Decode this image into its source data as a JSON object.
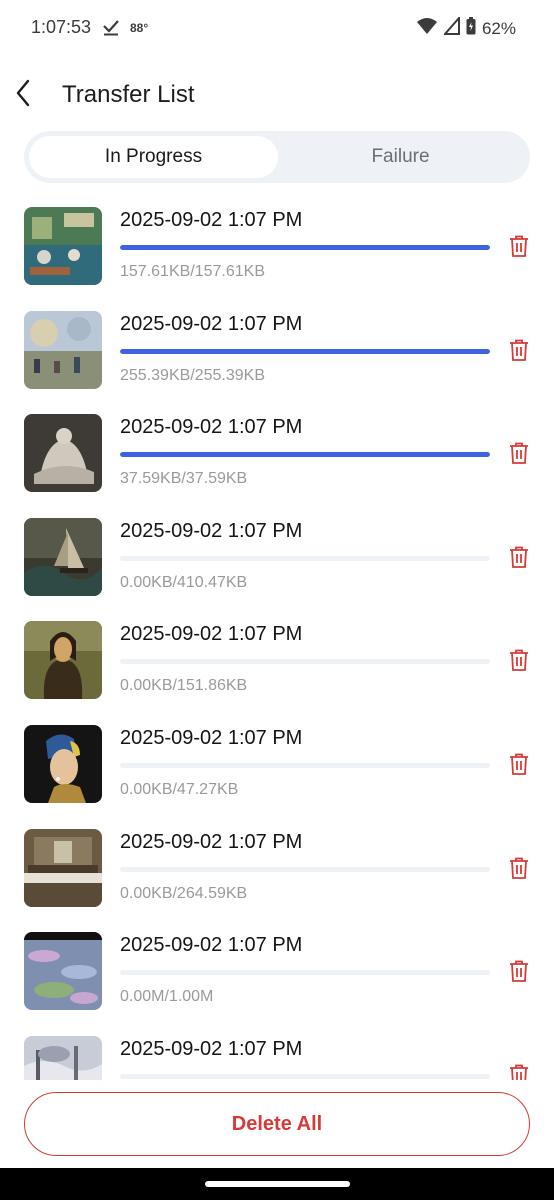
{
  "status": {
    "time": "1:07:53",
    "temp": "88°",
    "battery": "62%"
  },
  "header": {
    "title": "Transfer List"
  },
  "tabs": [
    {
      "label": "In Progress",
      "active": true
    },
    {
      "label": "Failure",
      "active": false
    }
  ],
  "items": [
    {
      "date": "2025-09-02 1:07 PM",
      "size": "157.61KB/157.61KB",
      "progress": 1.0,
      "image": "painting-boating-party"
    },
    {
      "date": "2025-09-02 1:07 PM",
      "size": "255.39KB/255.39KB",
      "progress": 1.0,
      "image": "painting-boulevard"
    },
    {
      "date": "2025-09-02 1:07 PM",
      "size": "37.59KB/37.59KB",
      "progress": 1.0,
      "image": "sculpture-pieta"
    },
    {
      "date": "2025-09-02 1:07 PM",
      "size": "0.00KB/410.47KB",
      "progress": 0.0,
      "image": "painting-ship-storm"
    },
    {
      "date": "2025-09-02 1:07 PM",
      "size": "0.00KB/151.86KB",
      "progress": 0.0,
      "image": "painting-mona-lisa"
    },
    {
      "date": "2025-09-02 1:07 PM",
      "size": "0.00KB/47.27KB",
      "progress": 0.0,
      "image": "painting-pearl-earring"
    },
    {
      "date": "2025-09-02 1:07 PM",
      "size": "0.00KB/264.59KB",
      "progress": 0.0,
      "image": "painting-last-supper"
    },
    {
      "date": "2025-09-02 1:07 PM",
      "size": "0.00M/1.00M",
      "progress": 0.0,
      "image": "painting-water-lilies"
    },
    {
      "date": "2025-09-02 1:07 PM",
      "size": "",
      "progress": 0.0,
      "image": "painting-snow-landscape"
    }
  ],
  "footer": {
    "delete_all_label": "Delete All"
  },
  "colors": {
    "accent": "#3d63e2",
    "danger": "#d83a37",
    "track": "#eef1f6"
  }
}
